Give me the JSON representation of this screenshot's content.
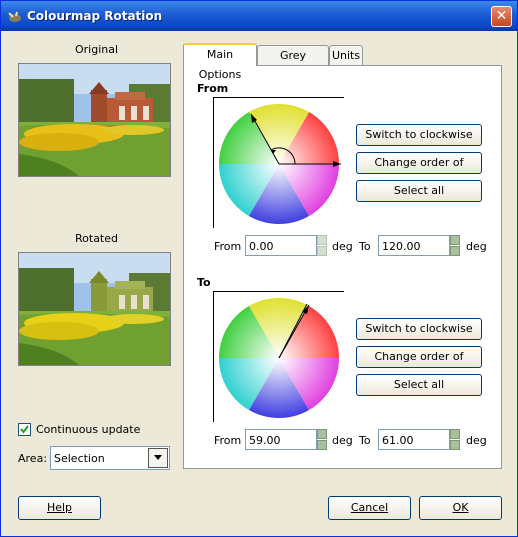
{
  "window": {
    "title": "Colourmap Rotation",
    "close_symbol": "✕",
    "app_icon": "gimp-wilber-icon"
  },
  "left": {
    "original_label": "Original",
    "rotated_label": "Rotated",
    "continuous_update_label": "Continuous update",
    "continuous_update_checked": true,
    "area_label": "Area:",
    "area_value": "Selection"
  },
  "tabs": [
    {
      "label": "Main Options",
      "active": true
    },
    {
      "label": "Grey Options",
      "active": false
    },
    {
      "label": "Units",
      "active": false
    }
  ],
  "from_section": {
    "title": "From",
    "buttons": [
      "Switch to clockwise",
      "Change order of arrows",
      "Select all"
    ],
    "from_label": "From",
    "from_value": "0.00",
    "deg1": "deg",
    "to_label": "To",
    "to_value": "120.00",
    "deg2": "deg"
  },
  "to_section": {
    "title": "To",
    "buttons": [
      "Switch to clockwise",
      "Change order of arrows",
      "Select all"
    ],
    "from_label": "From",
    "from_value": "59.00",
    "deg1": "deg",
    "to_label": "To",
    "to_value": "61.00",
    "deg2": "deg"
  },
  "footer": {
    "help_label": "Help",
    "cancel_label": "Cancel",
    "ok_label": "OK"
  },
  "colors": {
    "titlebar": "#0a46c6",
    "dialog_bg": "#ECE9D8",
    "close_button": "#c9461d"
  }
}
